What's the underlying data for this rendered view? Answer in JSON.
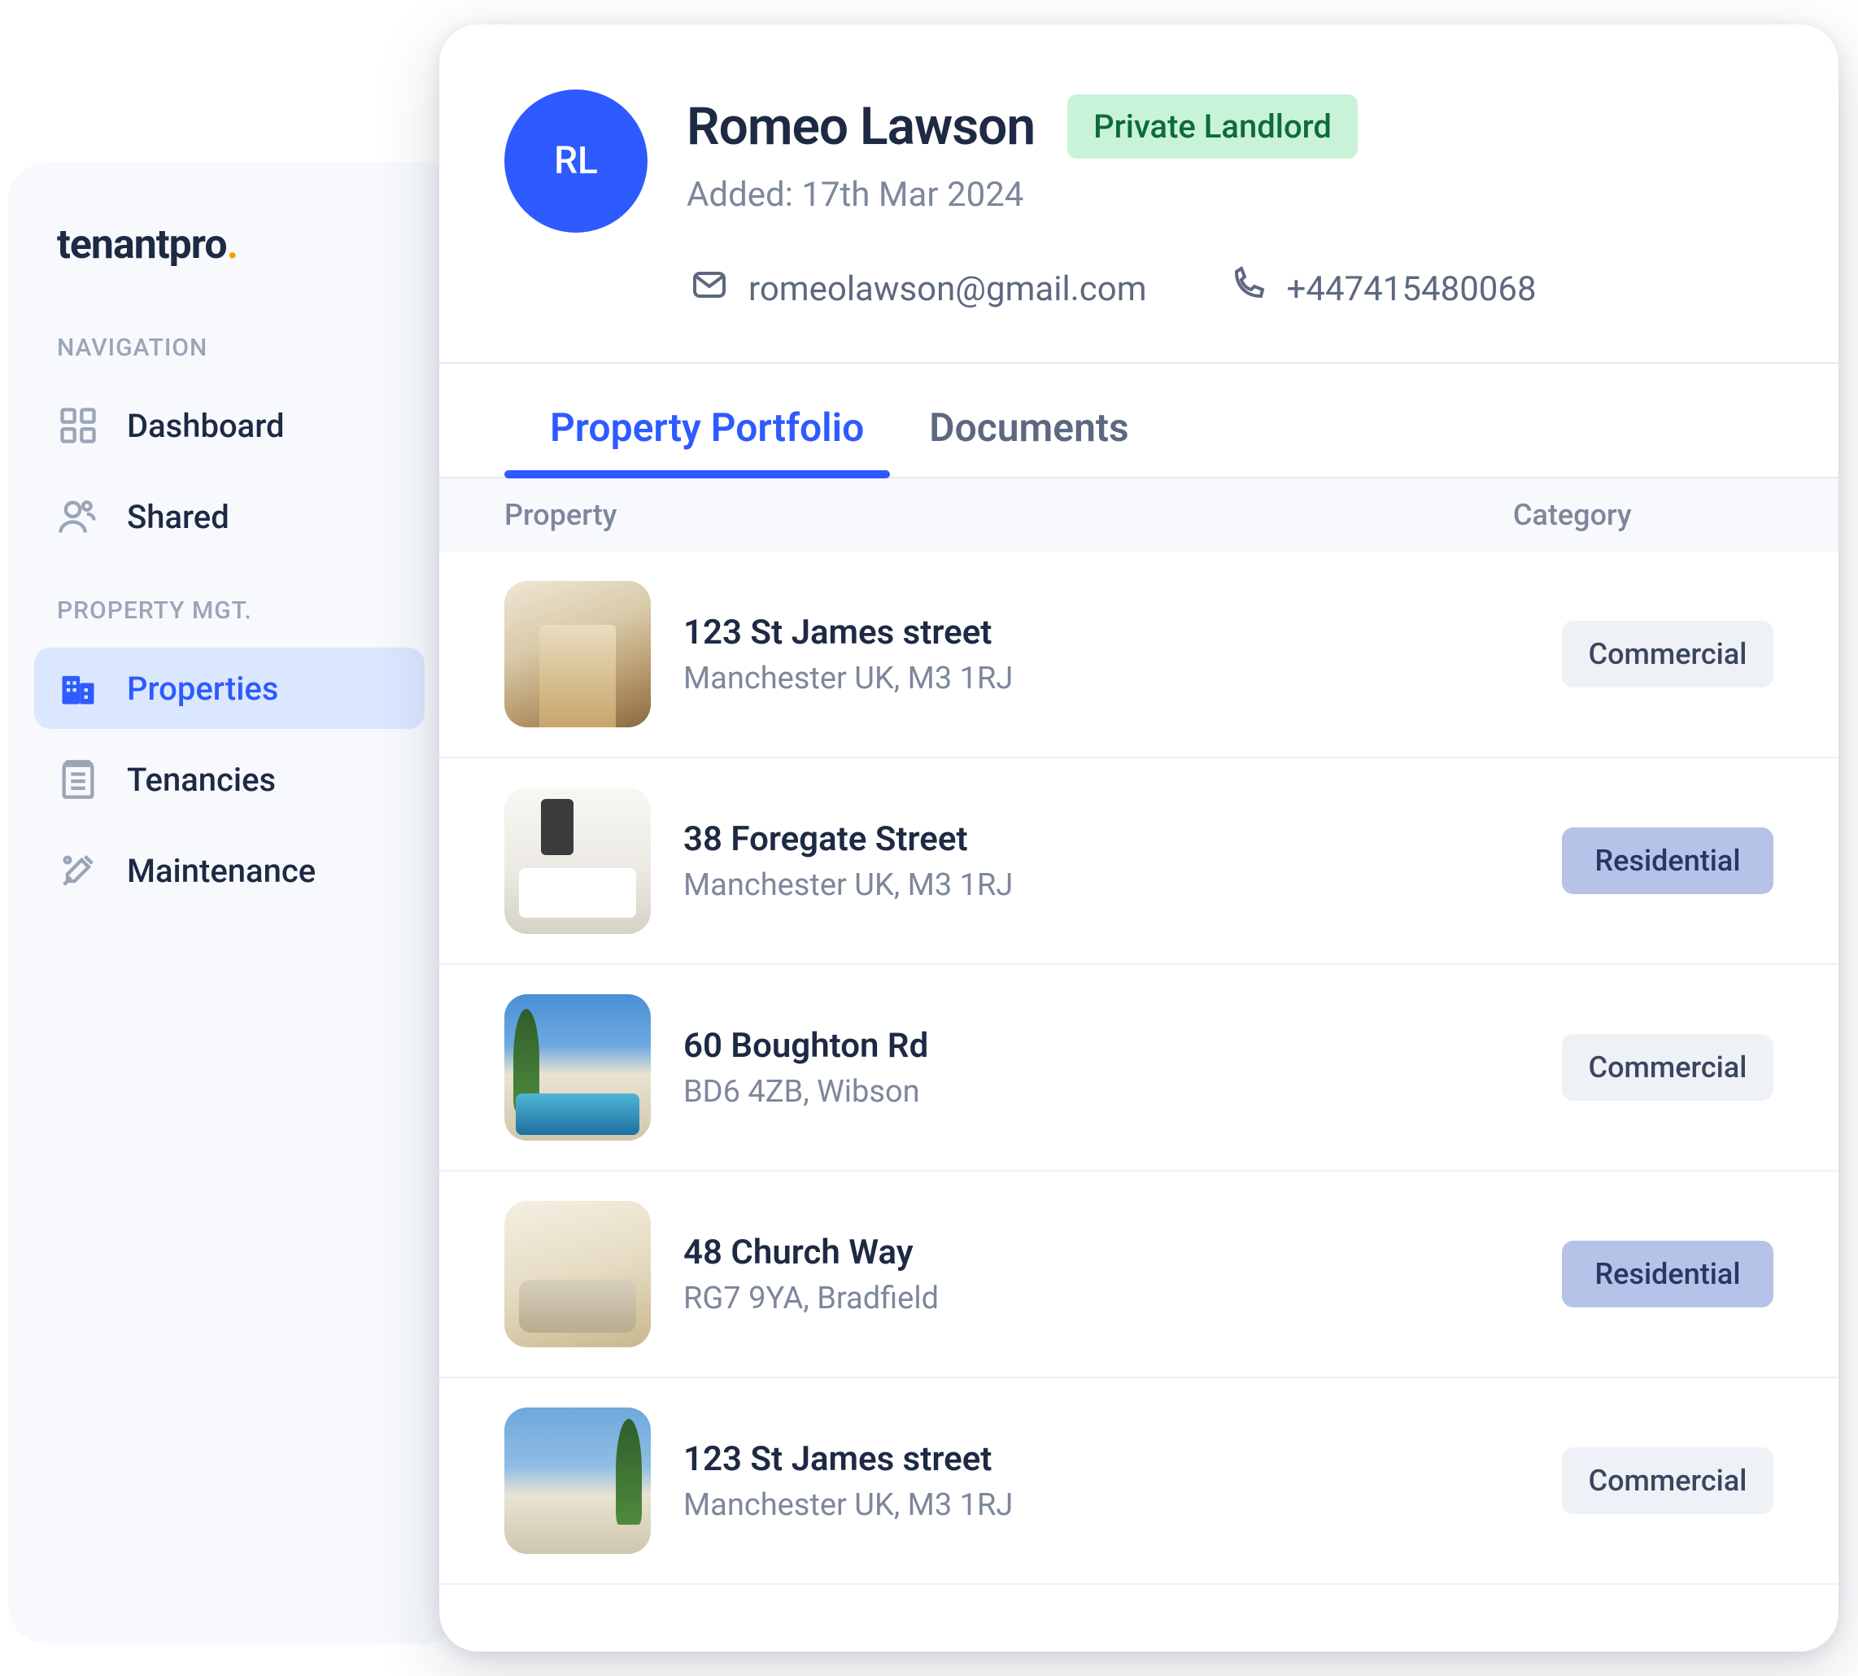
{
  "brand": {
    "name": "tenantpro",
    "accent_dot": "."
  },
  "sidebar": {
    "sections": [
      {
        "label": "NAVIGATION",
        "items": [
          {
            "icon": "dashboard-icon",
            "label": "Dashboard",
            "active": false
          },
          {
            "icon": "shared-icon",
            "label": "Shared",
            "active": false
          }
        ]
      },
      {
        "label": "PROPERTY MGT.",
        "items": [
          {
            "icon": "properties-icon",
            "label": "Properties",
            "active": true
          },
          {
            "icon": "tenancies-icon",
            "label": "Tenancies",
            "active": false
          },
          {
            "icon": "maintenance-icon",
            "label": "Maintenance",
            "active": false
          }
        ]
      }
    ]
  },
  "landlord": {
    "initials": "RL",
    "name": "Romeo Lawson",
    "type_badge": "Private Landlord",
    "added_line": "Added: 17th Mar 2024",
    "email": "romeolawson@gmail.com",
    "phone": "+447415480068"
  },
  "tabs": [
    {
      "label": "Property Portfolio",
      "active": true
    },
    {
      "label": "Documents",
      "active": false
    }
  ],
  "table": {
    "columns": {
      "property": "Property",
      "category": "Category"
    },
    "rows": [
      {
        "title": "123 St James street",
        "subtitle": "Manchester UK, M3 1RJ",
        "category": "Commercial",
        "category_style": "commercial",
        "thumb": "thumb-interior1"
      },
      {
        "title": "38 Foregate Street",
        "subtitle": "Manchester UK, M3 1RJ",
        "category": "Residential",
        "category_style": "residential",
        "thumb": "thumb-kitchen"
      },
      {
        "title": "60 Boughton Rd",
        "subtitle": "BD6 4ZB, Wibson",
        "category": "Commercial",
        "category_style": "commercial",
        "thumb": "thumb-villa"
      },
      {
        "title": "48 Church Way",
        "subtitle": "RG7 9YA, Bradfield",
        "category": "Residential",
        "category_style": "residential",
        "thumb": "thumb-living"
      },
      {
        "title": "123 St James street",
        "subtitle": "Manchester UK, M3 1RJ",
        "category": "Commercial",
        "category_style": "commercial",
        "thumb": "thumb-villa2"
      }
    ]
  },
  "colors": {
    "accent": "#2d5bff",
    "badge_green_bg": "#c9f3d8",
    "badge_residential_bg": "#b7c2e8",
    "badge_commercial_bg": "#eef1f6"
  }
}
